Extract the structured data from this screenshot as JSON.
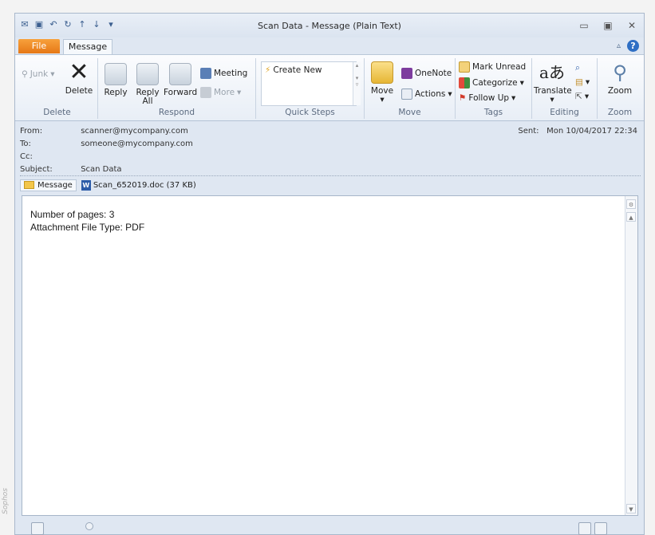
{
  "window": {
    "title": "Scan Data - Message (Plain Text)"
  },
  "tabs": {
    "file": "File",
    "message": "Message"
  },
  "ribbon": {
    "delete": {
      "junk": "Junk",
      "delete": "Delete",
      "group": "Delete"
    },
    "respond": {
      "reply": "Reply",
      "reply_all_1": "Reply",
      "reply_all_2": "All",
      "forward": "Forward",
      "meeting": "Meeting",
      "more": "More",
      "group": "Respond"
    },
    "quick_steps": {
      "create_new": "Create New",
      "group": "Quick Steps"
    },
    "move": {
      "move": "Move",
      "onenote": "OneNote",
      "actions": "Actions",
      "group": "Move"
    },
    "tags": {
      "mark_unread": "Mark Unread",
      "categorize": "Categorize",
      "follow_up": "Follow Up",
      "group": "Tags"
    },
    "editing": {
      "translate": "Translate",
      "group": "Editing"
    },
    "zoom": {
      "zoom": "Zoom",
      "group": "Zoom"
    }
  },
  "header": {
    "from_label": "From:",
    "from": "scanner@mycompany.com",
    "to_label": "To:",
    "to": "someone@mycompany.com",
    "cc_label": "Cc:",
    "subject_label": "Subject:",
    "subject": "Scan Data",
    "sent_label": "Sent:",
    "sent": "Mon 10/04/2017 22:34"
  },
  "attachments": {
    "message_tab": "Message",
    "file": "Scan_652019.doc (37 KB)"
  },
  "body": {
    "line1": "Number of pages: 3",
    "line2": "Attachment File Type: PDF"
  },
  "watermark": "Sophos"
}
